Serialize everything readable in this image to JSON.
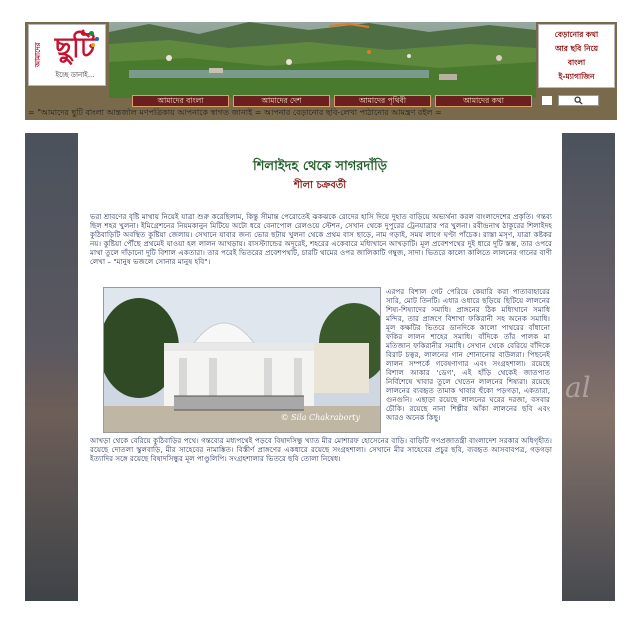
{
  "header": {
    "logo": {
      "main": "ছুটি",
      "side": "আমাদের",
      "tagline": "ইচ্ছে ডানাই..."
    },
    "tagline_lines": [
      "বেড়ানোর কথা",
      "আর ছবি নিয়ে",
      "বাংলা",
      "ই-ম্যাগাজিন"
    ],
    "nav": [
      "আমাদের বাংলা",
      "আমাদের দেশ",
      "আমাদের পৃথিবী",
      "আমাদের কথা"
    ],
    "search_icon": "search-icon"
  },
  "ticker": "= \"আমাদের ছুটি বাংলা আন্তর্জাল মণপত্রিকায় আপনাকে স্বাগত জানাই = আপনার বেড়ানোর ছবি-লেখা পাঠানোর আমন্ত্রণ রইল =",
  "article": {
    "title": "শিলাইদহ থেকে সাগরদাঁড়ি",
    "author": "শীলা চক্রবর্তী",
    "para1": "ভরা শ্রাবণের বৃষ্টি মাথায় নিয়েই যাত্রা শুরু করেছিলাম, কিন্তু সীমান্ত পেরোতেই ঝকঝকে রোদের হাসি দিয়ে দুহাত বাড়িয়ে অভ্যর্থনা করল বাংলাদেশের প্রকৃতি। গন্তব্য ছিল শহর খুলনা। ইমিগ্রেশনের নিয়মকানুন মিটিয়ে অটো ধরে বেনাপোল রেলওয়ে স্টেশন, সেখান থেকে দুপুরের ট্রেনযাত্রার পর খুলনা। রবীন্দ্রনাথ ঠাকুরের শিলাইদহ কুঠিবাড়িটি অবস্থিত কুষ্টিয়া জেলায়। সেখানে যাবার জন্য ভোর ছটায় খুলনা থেকে প্রথম বাস ছাড়ে, নাম গড়াই, সময় লাগে ঘণ্টা পাঁচেক। রাস্তা মসৃণ, যাত্রা কষ্টকর নয়। কুষ্টিয়া পৌঁছে প্রথমেই যাওয়া হল লালন আখড়ায়। বাসস্ট্যান্ডের অদূরেই, শহরের একেবারে মধ্যিখানে আখড়াটি। মূল প্রবেশপথের দুই ধারে দুটি স্তম্ভ, তার ওপরে মাথা তুলে দাঁড়ানো দুটি বিশাল একতারা। তার পরেই ভিতরের প্রবেশপথটি, চারটি থামের ওপর জালিকাটি গম্বুজ, সাদা। ভিতরে কালো কালিতে লালনের গানের বাণী লেখা – \"মানুষ ভজলে সোনার মানুষ হবি\"।",
    "para2": "এরপর বিশাল গেট পেরিয়ে কেয়ারি করা পাতাবাহারের সারি, মোট তিনটি। এধার ওধারে ছড়িয়ে ছিটিয়ে লালনের শিষ্য-শিষ্যাদের সমাধি। প্রাঙ্গনের ঠিক মধ্যিখানে সমাধি মন্দির, তার প্রাঙ্গণে বিশাখা ফকিরানী সহ অনেক সমাধি। মূল কক্ষটির ভিতরে ডানদিকে কালো পাথরের বাঁধানো ফকির লালন শাহের সমাধি। বাঁদিকে তাঁর পালক মা মতিজান ফকিরানীর সমাধি। সেখান থেকে বেরিয়ে বাঁদিকে বিরাট চত্বর, লালনের গান শোনানোর বাউলরা। পিছনেই লালন সম্পর্কে গবেষণাগার এবং সংগ্রহশালা। রয়েছে বিশাল আকার 'ডেগ', এই হাঁড়ি থেকেই জাতপাত নির্বিশেষে খাবার তুলে খেতেন লালনের শিষ্যরা। রয়েছে লালনের ব্যবহৃত তামাক খাবার হুঁকো পড়গড়া, একতারা, গুনগুনি। এছাড়া রয়েছে লালনের ঘরের দরজা, বসবার চৌকি। রয়েছে নানা শিল্পীর আঁকা লালনের ছবি এবং আরও অনেক কিছু।",
    "para3": "আখড়া থেকে বেরিয়ে কুঠিবাড়ির পথে। গন্তব্যের মধ্যপথেই পড়বে বিষাদসিন্ধু খ্যাত মীর মোশারফ হোসেনের বাড়ি। বাড়িটি গণপ্রজাতন্ত্রী বাংলাদেশ সরকার অধিগৃহীত। রয়েছে দোতলা স্কুলবাড়ি, মীর সাহেবের নামাঙ্কিত। বিস্তীর্ণ প্রাঙ্গণের একধারে রয়েছে সংগ্রহশালা। সেখানে মীর সাহেবের প্রচুর ছবি, ব্যবহৃত আসবাবপত্র, গড়গড়া ইত্যাদির সঙ্গে রয়েছে বিষাদসিন্ধুর মূল পাণ্ডুলিপি। সংগ্রহশালার ভিতরে ছবি তোলা নিষেধ।",
    "photo_credit": "© Sila Chakraborty"
  },
  "colors": {
    "nav_bg": "#6b1f1f",
    "title": "#1f5e2a",
    "author": "#8a1a1a",
    "body_text": "#1b2a52"
  }
}
